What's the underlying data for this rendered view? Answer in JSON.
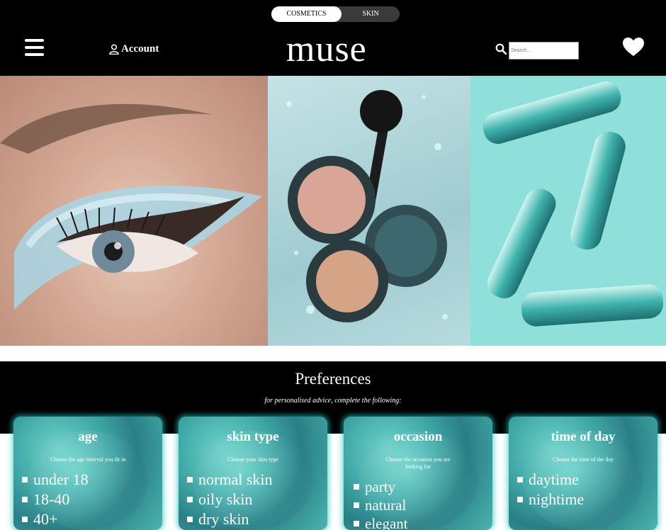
{
  "header": {
    "toggle": {
      "active": "COSMETICS",
      "inactive": "SKIN"
    },
    "account_label": "Account",
    "logo": "muse",
    "search": {
      "placeholder": "Search..."
    }
  },
  "colors": {
    "bar": "#000000",
    "accent": "#3fa7a6"
  },
  "preferences": {
    "title": "Preferences",
    "subtitle": "for personalised advice, complete the following:",
    "cards": [
      {
        "title": "age",
        "description": "Choose the age interval you fit in",
        "options": [
          "under 18",
          "18-40",
          "40+"
        ]
      },
      {
        "title": "skin type",
        "description": "Choose your skin type",
        "options": [
          "normal skin",
          "oily skin",
          "dry skin"
        ]
      },
      {
        "title": "occasion",
        "description": "Choose the occasion you are looking for",
        "options": [
          "party",
          "natural",
          "elegant"
        ]
      },
      {
        "title": "time of day",
        "description": "Choose the time of the day",
        "options": [
          "daytime",
          "nightime"
        ]
      }
    ]
  }
}
